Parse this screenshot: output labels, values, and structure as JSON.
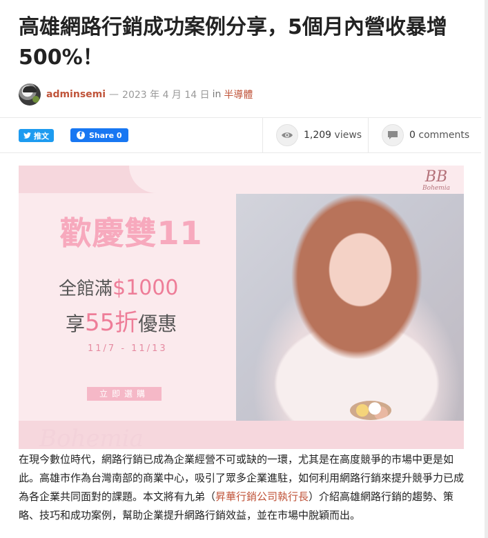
{
  "article": {
    "title": "高雄網路行銷成功案例分享，5個月內營收暴增500%！",
    "author": "adminsemi",
    "date_sep": "—",
    "date": "2023 年 4 月 14 日",
    "in_word": "in",
    "category": "半導體"
  },
  "share": {
    "twitter_label": "推文",
    "facebook_label": "Share 0"
  },
  "stats": {
    "views_count": "1,209",
    "views_label": "views",
    "comments_count": "0",
    "comments_label": "comments"
  },
  "icons": {
    "twitter": "bird-icon",
    "facebook": "facebook-f-icon",
    "views": "eye-icon",
    "comments": "speech-bubble-icon"
  },
  "banner": {
    "brand_logo": "BB",
    "brand_name": "Bohemia",
    "title": "歡慶雙11",
    "line1_prefix": "全館滿",
    "line1_price": "$1000",
    "line2_prefix": "享",
    "line2_discount": "55折",
    "line2_suffix": "優惠",
    "dates": "11/7 - 11/13",
    "button": "立即選購",
    "watermark": "Bohemia"
  },
  "body": {
    "p1_before": "在現今數位時代，網路行銷已成為企業經營不可或缺的一環，尤其是在高度競爭的市場中更是如此。高雄市作為台灣南部的商業中心，吸引了眾多企業進駐，如何利用網路行銷來提升競爭力已成為各企業共同面對的課題。本文將有九弟（",
    "p1_link": "昇華行銷公司執行長",
    "p1_after": "）介紹高雄網路行銷的趨勢、策略、技巧和成功案例，幫助企業提升網路行銷效益，並在市場中脫穎而出。"
  },
  "colors": {
    "accent": "#c0543a",
    "twitter": "#1d9bf0",
    "facebook": "#1877f2",
    "promo_pink": "#ee7d98"
  }
}
